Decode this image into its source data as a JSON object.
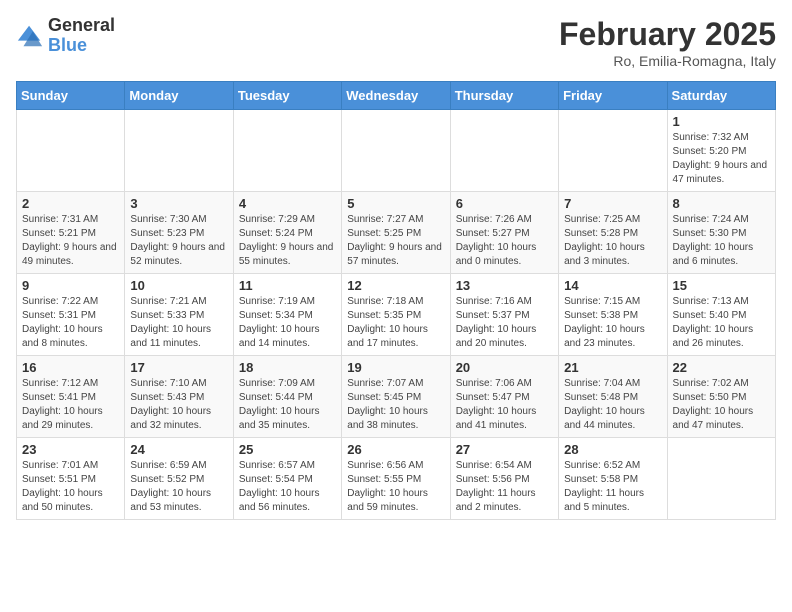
{
  "header": {
    "logo_general": "General",
    "logo_blue": "Blue",
    "month_title": "February 2025",
    "location": "Ro, Emilia-Romagna, Italy"
  },
  "days_of_week": [
    "Sunday",
    "Monday",
    "Tuesday",
    "Wednesday",
    "Thursday",
    "Friday",
    "Saturday"
  ],
  "weeks": [
    [
      {
        "day": "",
        "info": ""
      },
      {
        "day": "",
        "info": ""
      },
      {
        "day": "",
        "info": ""
      },
      {
        "day": "",
        "info": ""
      },
      {
        "day": "",
        "info": ""
      },
      {
        "day": "",
        "info": ""
      },
      {
        "day": "1",
        "info": "Sunrise: 7:32 AM\nSunset: 5:20 PM\nDaylight: 9 hours and 47 minutes."
      }
    ],
    [
      {
        "day": "2",
        "info": "Sunrise: 7:31 AM\nSunset: 5:21 PM\nDaylight: 9 hours and 49 minutes."
      },
      {
        "day": "3",
        "info": "Sunrise: 7:30 AM\nSunset: 5:23 PM\nDaylight: 9 hours and 52 minutes."
      },
      {
        "day": "4",
        "info": "Sunrise: 7:29 AM\nSunset: 5:24 PM\nDaylight: 9 hours and 55 minutes."
      },
      {
        "day": "5",
        "info": "Sunrise: 7:27 AM\nSunset: 5:25 PM\nDaylight: 9 hours and 57 minutes."
      },
      {
        "day": "6",
        "info": "Sunrise: 7:26 AM\nSunset: 5:27 PM\nDaylight: 10 hours and 0 minutes."
      },
      {
        "day": "7",
        "info": "Sunrise: 7:25 AM\nSunset: 5:28 PM\nDaylight: 10 hours and 3 minutes."
      },
      {
        "day": "8",
        "info": "Sunrise: 7:24 AM\nSunset: 5:30 PM\nDaylight: 10 hours and 6 minutes."
      }
    ],
    [
      {
        "day": "9",
        "info": "Sunrise: 7:22 AM\nSunset: 5:31 PM\nDaylight: 10 hours and 8 minutes."
      },
      {
        "day": "10",
        "info": "Sunrise: 7:21 AM\nSunset: 5:33 PM\nDaylight: 10 hours and 11 minutes."
      },
      {
        "day": "11",
        "info": "Sunrise: 7:19 AM\nSunset: 5:34 PM\nDaylight: 10 hours and 14 minutes."
      },
      {
        "day": "12",
        "info": "Sunrise: 7:18 AM\nSunset: 5:35 PM\nDaylight: 10 hours and 17 minutes."
      },
      {
        "day": "13",
        "info": "Sunrise: 7:16 AM\nSunset: 5:37 PM\nDaylight: 10 hours and 20 minutes."
      },
      {
        "day": "14",
        "info": "Sunrise: 7:15 AM\nSunset: 5:38 PM\nDaylight: 10 hours and 23 minutes."
      },
      {
        "day": "15",
        "info": "Sunrise: 7:13 AM\nSunset: 5:40 PM\nDaylight: 10 hours and 26 minutes."
      }
    ],
    [
      {
        "day": "16",
        "info": "Sunrise: 7:12 AM\nSunset: 5:41 PM\nDaylight: 10 hours and 29 minutes."
      },
      {
        "day": "17",
        "info": "Sunrise: 7:10 AM\nSunset: 5:43 PM\nDaylight: 10 hours and 32 minutes."
      },
      {
        "day": "18",
        "info": "Sunrise: 7:09 AM\nSunset: 5:44 PM\nDaylight: 10 hours and 35 minutes."
      },
      {
        "day": "19",
        "info": "Sunrise: 7:07 AM\nSunset: 5:45 PM\nDaylight: 10 hours and 38 minutes."
      },
      {
        "day": "20",
        "info": "Sunrise: 7:06 AM\nSunset: 5:47 PM\nDaylight: 10 hours and 41 minutes."
      },
      {
        "day": "21",
        "info": "Sunrise: 7:04 AM\nSunset: 5:48 PM\nDaylight: 10 hours and 44 minutes."
      },
      {
        "day": "22",
        "info": "Sunrise: 7:02 AM\nSunset: 5:50 PM\nDaylight: 10 hours and 47 minutes."
      }
    ],
    [
      {
        "day": "23",
        "info": "Sunrise: 7:01 AM\nSunset: 5:51 PM\nDaylight: 10 hours and 50 minutes."
      },
      {
        "day": "24",
        "info": "Sunrise: 6:59 AM\nSunset: 5:52 PM\nDaylight: 10 hours and 53 minutes."
      },
      {
        "day": "25",
        "info": "Sunrise: 6:57 AM\nSunset: 5:54 PM\nDaylight: 10 hours and 56 minutes."
      },
      {
        "day": "26",
        "info": "Sunrise: 6:56 AM\nSunset: 5:55 PM\nDaylight: 10 hours and 59 minutes."
      },
      {
        "day": "27",
        "info": "Sunrise: 6:54 AM\nSunset: 5:56 PM\nDaylight: 11 hours and 2 minutes."
      },
      {
        "day": "28",
        "info": "Sunrise: 6:52 AM\nSunset: 5:58 PM\nDaylight: 11 hours and 5 minutes."
      },
      {
        "day": "",
        "info": ""
      }
    ]
  ]
}
